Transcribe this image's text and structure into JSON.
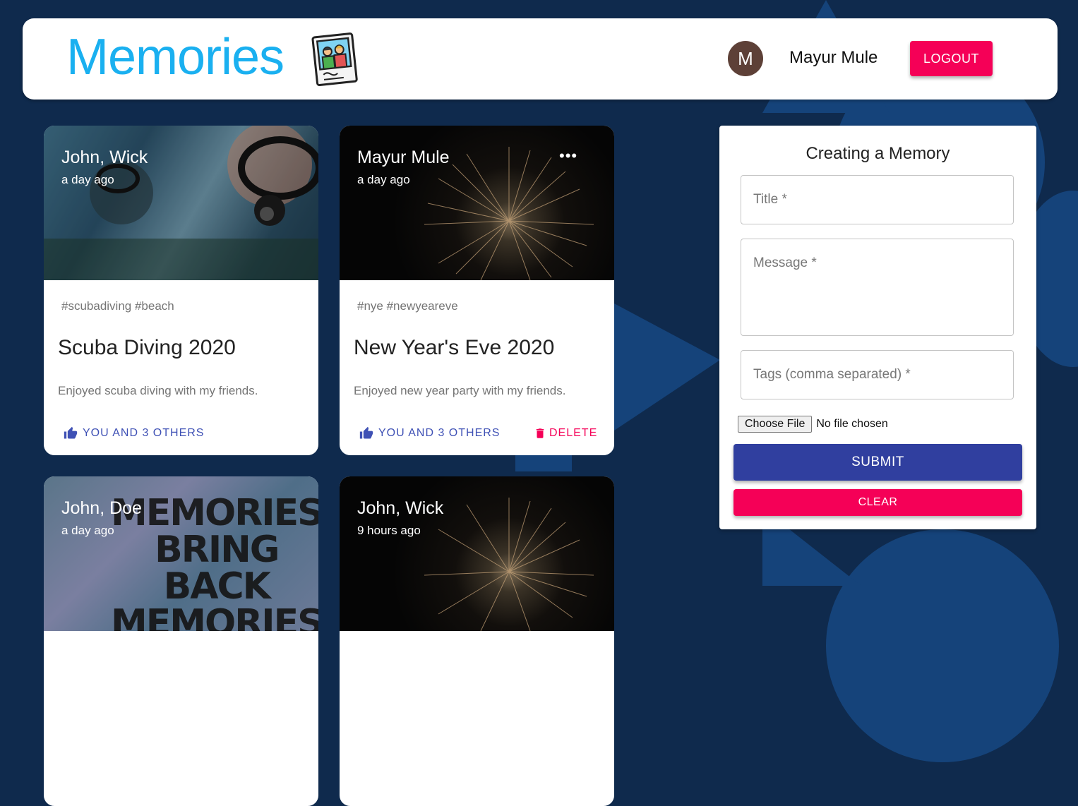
{
  "appbar": {
    "brand": "Memories",
    "brand_icon": "polaroid-photo-icon",
    "avatar_letter": "M",
    "username": "Mayur Mule",
    "logout_label": "LOGOUT"
  },
  "posts": [
    {
      "author": "John, Wick",
      "time": "a day ago",
      "tags": "#scubadiving #beach",
      "title": "Scuba Diving 2020",
      "message": "Enjoyed scuba diving with my friends.",
      "likes": "YOU AND 3 OTHERS"
    },
    {
      "author": "Mayur Mule",
      "time": "a day ago",
      "more": "•••",
      "tags": "#nye #newyeareve",
      "title": "New Year's Eve 2020",
      "message": "Enjoyed new year party with my friends.",
      "likes": "YOU AND 3 OTHERS",
      "delete_label": "DELETE"
    },
    {
      "author": "John, Doe",
      "time": "a day ago",
      "image_text": [
        "MEMORIES",
        "BRING BACK",
        "MEMORIES"
      ]
    },
    {
      "author": "John, Wick",
      "time": "9 hours ago"
    }
  ],
  "form": {
    "title": "Creating a Memory",
    "title_label": "Title *",
    "message_label": "Message *",
    "tags_label": "Tags (comma separated) *",
    "file_button": "Choose File",
    "file_status": "No file chosen",
    "submit_label": "SUBMIT",
    "clear_label": "CLEAR"
  },
  "colors": {
    "background": "#0f2a4d",
    "brand": "#1ab0f0",
    "primary": "#303f9f",
    "like": "#3f51b5",
    "secondary": "#f50057",
    "avatar": "#5d4037"
  }
}
